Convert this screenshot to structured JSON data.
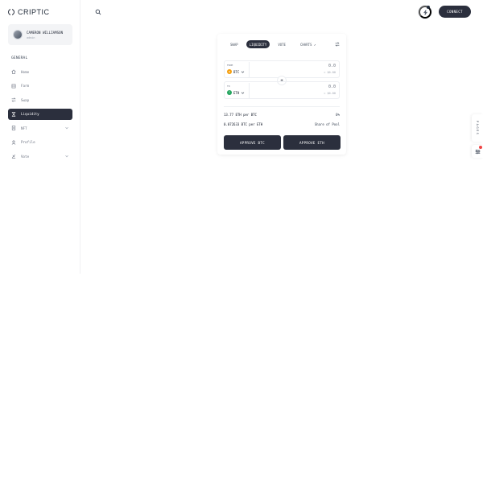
{
  "brand": {
    "name": "CRIPTIC",
    "logo_icon": "criptic-logo-icon"
  },
  "user": {
    "name": "CAMERON WILLIAMSON",
    "role": "admin"
  },
  "sidebar": {
    "section_title": "GENERAL",
    "items": [
      {
        "label": "Home",
        "icon": "home-icon",
        "active": false,
        "has_chevron": false
      },
      {
        "label": "Farm",
        "icon": "farm-icon",
        "active": false,
        "has_chevron": false
      },
      {
        "label": "Swap",
        "icon": "swap-icon",
        "active": false,
        "has_chevron": false
      },
      {
        "label": "Liquidity",
        "icon": "liquidity-icon",
        "active": true,
        "has_chevron": false
      },
      {
        "label": "NFT",
        "icon": "nft-icon",
        "active": false,
        "has_chevron": true
      },
      {
        "label": "Profile",
        "icon": "profile-icon",
        "active": false,
        "has_chevron": false
      },
      {
        "label": "Vote",
        "icon": "vote-icon",
        "active": false,
        "has_chevron": true
      }
    ]
  },
  "header": {
    "connect_label": "CONNECT"
  },
  "liquidity_card": {
    "tabs": [
      {
        "label": "SWAP",
        "active": false
      },
      {
        "label": "LIQUIDITY",
        "active": true
      },
      {
        "label": "VOTE",
        "active": false
      },
      {
        "label": "CHARTS ↗",
        "active": false
      }
    ],
    "from": {
      "label": "FROM",
      "token": "BTC",
      "amount": "0.0",
      "usd": "= $0.00"
    },
    "to": {
      "label": "TO",
      "token": "ETH",
      "amount": "0.0",
      "usd": "= $0.00"
    },
    "rates": [
      {
        "left": "13.77 ETH per BTC",
        "right": "0%"
      },
      {
        "left": "0.072633 BTC per ETH",
        "right": "Share of Pool"
      }
    ],
    "approve_btc_label": "APPROVE BTC",
    "approve_eth_label": "APPROVE ETH"
  },
  "side_tabs": {
    "pages_label": "PAGES"
  },
  "colors": {
    "primary": "#2b2f3d",
    "btc": "#f59e0b",
    "eth": "#22a45d",
    "alert": "#ef4444"
  }
}
